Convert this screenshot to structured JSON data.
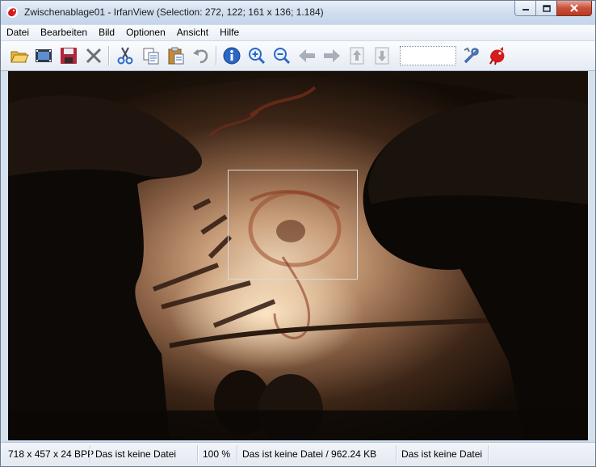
{
  "window": {
    "title": "Zwischenablage01 - IrfanView (Selection: 272, 122; 161 x 136; 1.184)"
  },
  "menu": [
    "Datei",
    "Bearbeiten",
    "Bild",
    "Optionen",
    "Ansicht",
    "Hilfe"
  ],
  "toolbar": {
    "icons": [
      "open-folder-icon",
      "slideshow-icon",
      "save-icon",
      "delete-icon",
      "cut-icon",
      "copy-icon",
      "paste-icon",
      "undo-icon",
      "info-icon",
      "zoom-in-icon",
      "zoom-out-icon",
      "previous-icon",
      "next-icon",
      "page-up-icon",
      "page-down-icon",
      "settings-icon",
      "irfanview-icon"
    ]
  },
  "colors": {
    "accent": "#3a6fc4",
    "close": "#c8503a"
  },
  "status": {
    "dimensions": "718 x 457 x 24 BPP",
    "file_info_1": "Das ist keine Datei",
    "zoom": "100 %",
    "file_info_2": "Das ist keine Datei / 962.24 KB",
    "file_info_3": "Das ist keine Datei"
  }
}
